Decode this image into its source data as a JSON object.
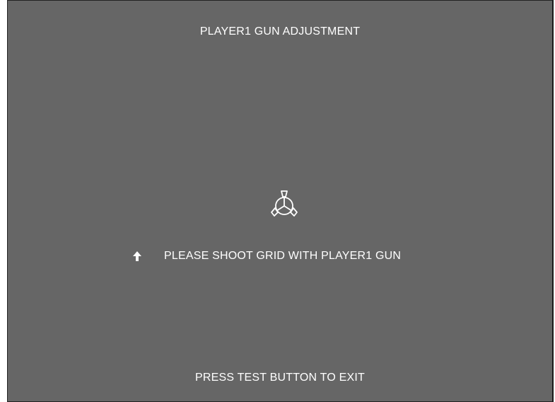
{
  "screen": {
    "title": "PLAYER1 GUN ADJUSTMENT",
    "instruction": "PLEASE SHOOT GRID WITH PLAYER1 GUN",
    "footer": "PRESS TEST BUTTON TO EXIT"
  },
  "icons": {
    "target": "crosshair-target-icon",
    "pointer": "up-arrow-icon"
  },
  "colors": {
    "background": "#666666",
    "text": "#ffffff"
  }
}
